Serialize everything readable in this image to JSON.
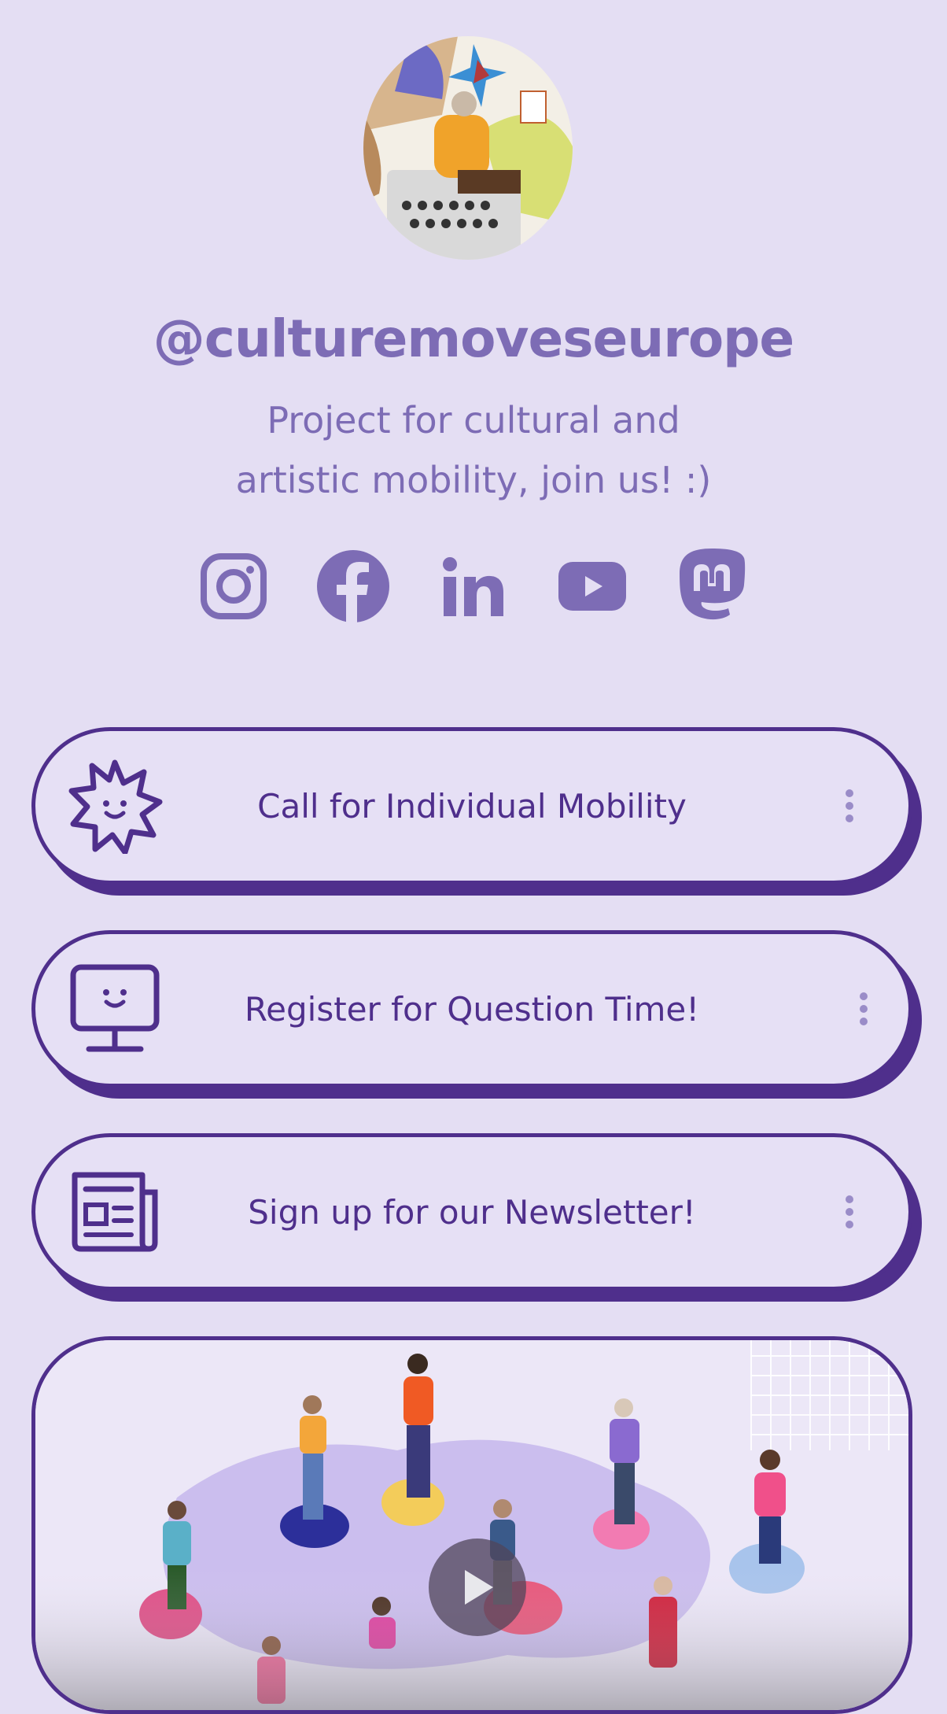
{
  "profile": {
    "handle": "@culturemoveseurope",
    "bio_line1": "Project for cultural and",
    "bio_line2": "artistic mobility, join us! :)"
  },
  "social_icons": [
    "instagram-icon",
    "facebook-icon",
    "linkedin-icon",
    "youtube-icon",
    "mastodon-icon"
  ],
  "links": [
    {
      "title": "Call for Individual Mobility",
      "icon": "star-smile-icon"
    },
    {
      "title": "Register for Question Time!",
      "icon": "monitor-smile-icon"
    },
    {
      "title": "Sign up for our Newsletter!",
      "icon": "newspaper-icon"
    }
  ],
  "colors": {
    "background": "#e4def3",
    "text_soft": "#7d6cb5",
    "accent": "#4f2f8c"
  }
}
